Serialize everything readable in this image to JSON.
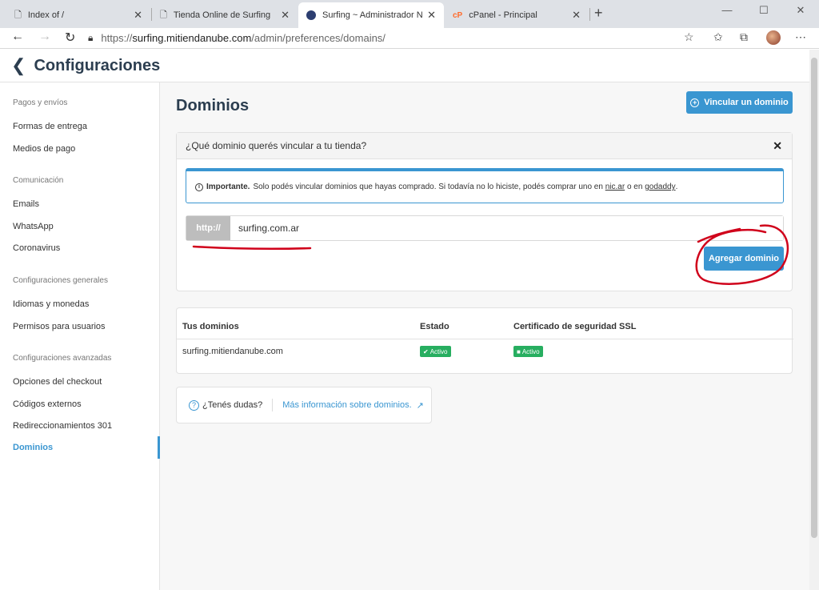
{
  "browser": {
    "tabs": [
      {
        "title": "Index of /",
        "active": false
      },
      {
        "title": "Tienda Online de Surfing",
        "active": false
      },
      {
        "title": "Surfing ~ Administrador Nube -",
        "active": true
      },
      {
        "title": "cPanel - Principal",
        "active": false
      }
    ],
    "new_tab": "+",
    "url_prefix": "https://",
    "url_host": "surfing.mitiendanube.com",
    "url_path": "/admin/preferences/domains/"
  },
  "header": {
    "back": "❮",
    "title": "Configuraciones"
  },
  "sidebar": {
    "groups": [
      {
        "label": "Pagos y envíos",
        "items": [
          "Formas de entrega",
          "Medios de pago"
        ]
      },
      {
        "label": "Comunicación",
        "items": [
          "Emails",
          "WhatsApp",
          "Coronavirus"
        ]
      },
      {
        "label": "Configuraciones generales",
        "items": [
          "Idiomas y monedas",
          "Permisos para usuarios"
        ]
      },
      {
        "label": "Configuraciones avanzadas",
        "items": [
          "Opciones del checkout",
          "Códigos externos",
          "Redireccionamientos 301",
          "Dominios"
        ]
      }
    ],
    "active_item": "Dominios"
  },
  "main": {
    "title": "Dominios",
    "link_domain_button": "Vincular un dominio",
    "card": {
      "question": "¿Qué dominio querés vincular a tu tienda?",
      "notice": {
        "strong": "Importante.",
        "text_1": "Solo podés vincular dominios que hayas comprado. Si todavía no lo hiciste, podés comprar uno en",
        "link_1": "nic.ar",
        "text_2": "o en",
        "link_2": "godaddy",
        "text_3": "."
      },
      "input_prefix": "http://",
      "input_value": "surfing.com.ar",
      "add_button": "Agregar dominio"
    },
    "table": {
      "headers": [
        "Tus dominios",
        "Estado",
        "Certificado de seguridad SSL"
      ],
      "row": {
        "domain": "surfing.mitiendanube.com",
        "status": "Activo",
        "ssl": "Activo"
      }
    },
    "help": {
      "question": "¿Tenés dudas?",
      "link": "Más información sobre dominios."
    }
  },
  "colors": {
    "accent": "#3a96d1",
    "success": "#27ae60",
    "annotation": "#d0021b"
  }
}
